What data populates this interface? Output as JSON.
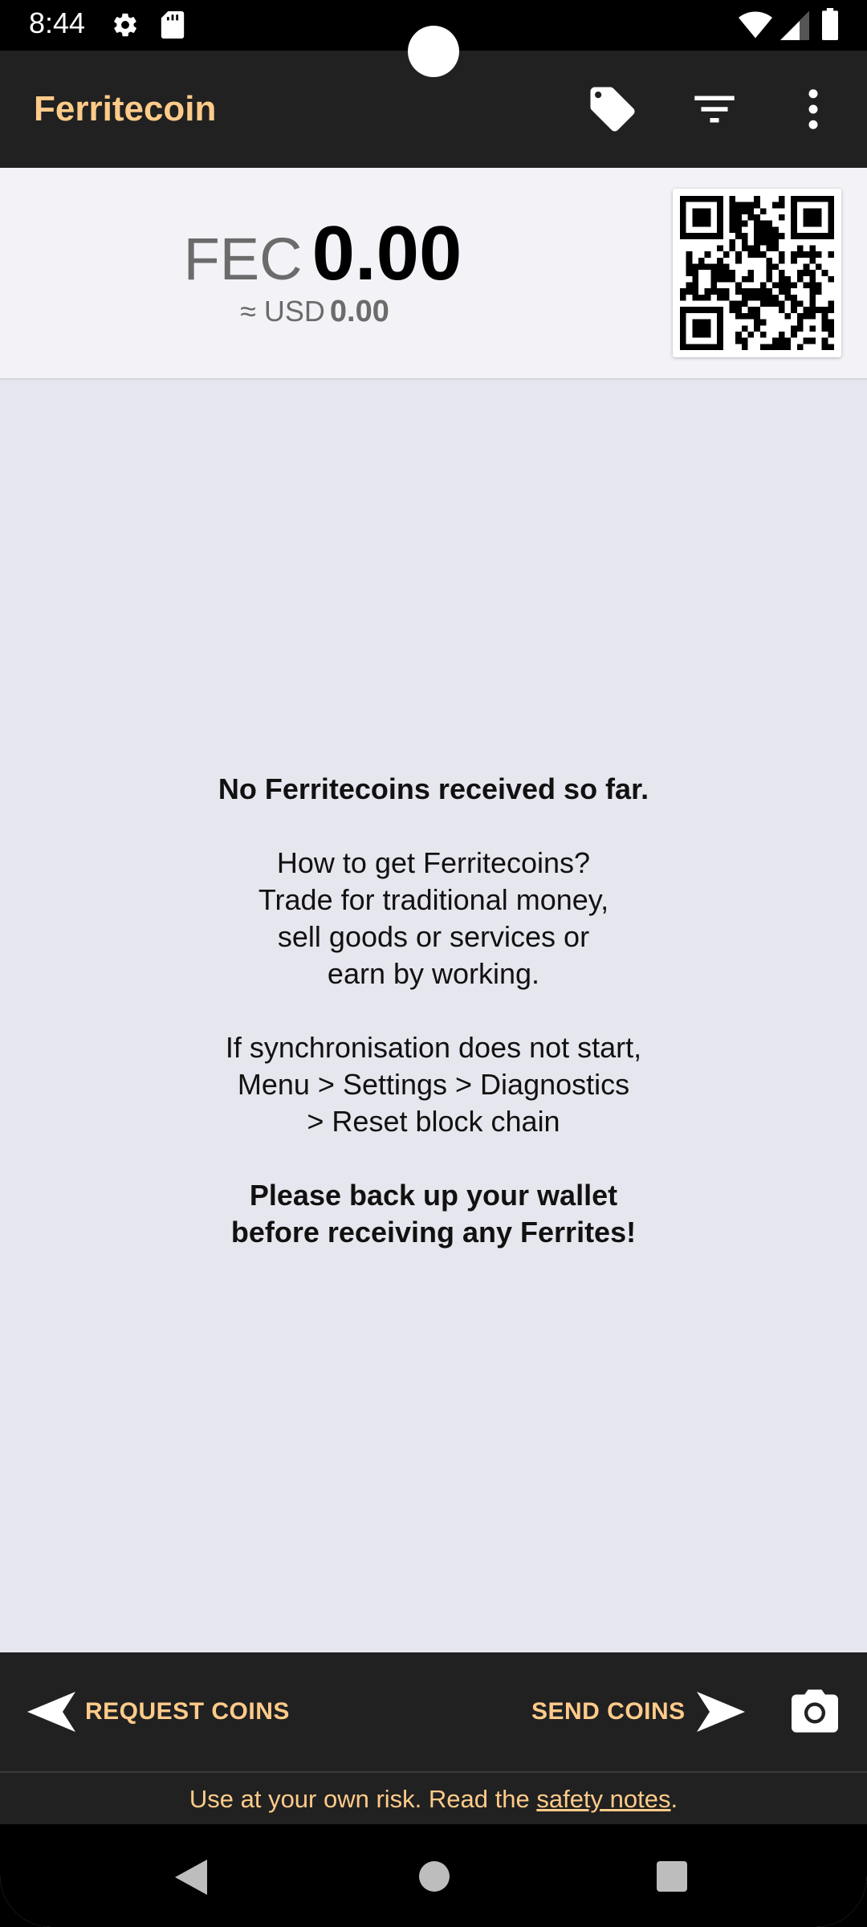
{
  "status_bar": {
    "time": "8:44",
    "icons": [
      "gear-icon",
      "sd-card-icon",
      "wifi-icon",
      "signal-icon",
      "battery-icon"
    ]
  },
  "app_bar": {
    "title": "Ferritecoin",
    "actions": [
      "tag-icon",
      "filter-icon",
      "more-vert-icon"
    ],
    "title_color": "#ffcb8a",
    "background": "#212121"
  },
  "balance": {
    "currency_code": "FEC",
    "amount": "0.00",
    "local_prefix": "≈ USD",
    "local_amount": "0.00"
  },
  "empty_message": {
    "title": "No Ferritecoins received so far.",
    "how_lines": [
      "How to get Ferritecoins?",
      "Trade for traditional money,",
      "sell goods or services or",
      "earn by working."
    ],
    "sync_lines": [
      "If synchronisation does not start,",
      "Menu > Settings > Diagnostics",
      "> Reset block chain"
    ],
    "backup_lines": [
      "Please back up your wallet",
      "before receiving any Ferrites!"
    ]
  },
  "actions": {
    "request_label": "REQUEST COINS",
    "send_label": "SEND COINS",
    "camera_icon": "camera-icon"
  },
  "disclaimer": {
    "prefix": "Use at your own risk. Read the ",
    "link": "safety notes",
    "suffix": "."
  },
  "nav_bar": {
    "buttons": [
      "back-icon",
      "home-icon",
      "recents-icon"
    ]
  }
}
